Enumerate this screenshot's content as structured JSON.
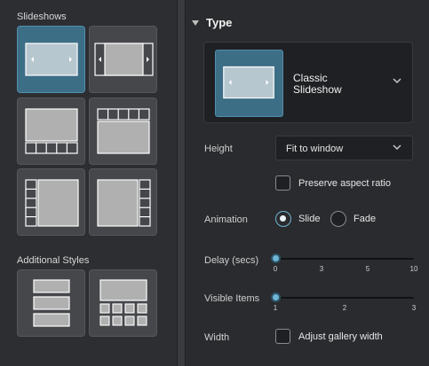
{
  "left": {
    "slideshows_title": "Slideshows",
    "additional_title": "Additional Styles"
  },
  "type_section": {
    "header": "Type",
    "selected_name_line1": "Classic",
    "selected_name_line2": "Slideshow"
  },
  "height": {
    "label": "Height",
    "value": "Fit to window"
  },
  "preserve": {
    "label": "Preserve aspect ratio",
    "checked": false
  },
  "animation": {
    "label": "Animation",
    "options": [
      "Slide",
      "Fade"
    ],
    "selected": "Slide"
  },
  "delay": {
    "label": "Delay (secs)",
    "ticks": [
      "0",
      "3",
      "5",
      "10"
    ],
    "value": 0
  },
  "visible": {
    "label": "Visible Items",
    "ticks": [
      "1",
      "2",
      "3"
    ],
    "value": 1
  },
  "width": {
    "label": "Width",
    "checkbox_label": "Adjust gallery width",
    "checked": false
  },
  "colors": {
    "accent": "#6fb6d6",
    "selected_tile": "#3c6e86"
  }
}
